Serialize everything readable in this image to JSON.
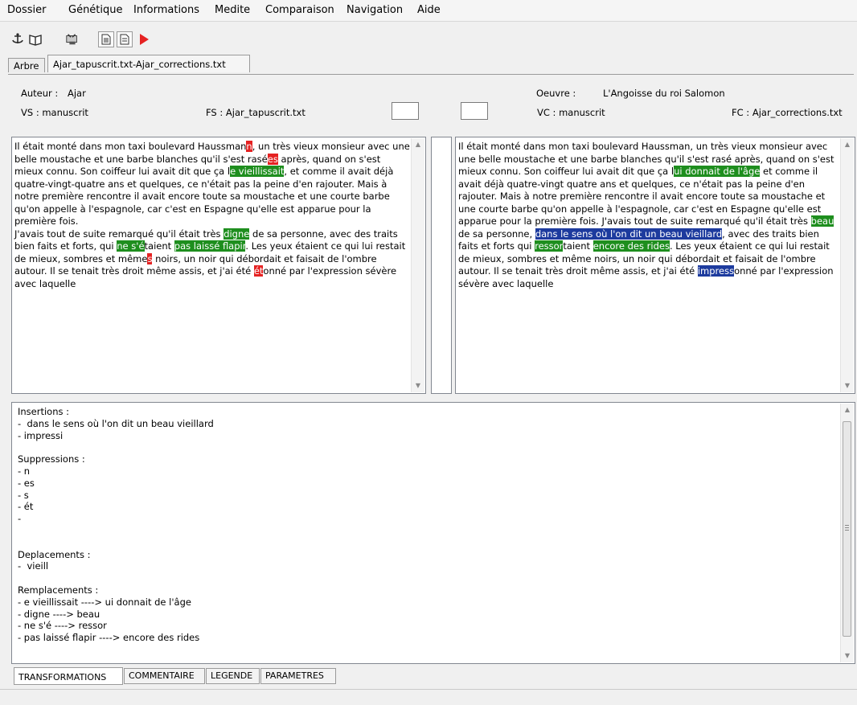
{
  "menu": [
    "Dossier",
    "Génétique",
    "Informations",
    "Medite",
    "Comparaison",
    "Navigation",
    "Aide"
  ],
  "toolbar": {
    "icons": [
      "anchor-icon",
      "book-icon",
      "tools-icon",
      "document-icon",
      "document-alt-icon",
      "play-icon"
    ],
    "accent_color": "#e52222"
  },
  "tabs": [
    "Arbre",
    "Ajar_tapuscrit.txt-Ajar_corrections.txt"
  ],
  "header": {
    "author_label": "Auteur :",
    "author": "Ajar",
    "oeuvre_label": "Oeuvre :",
    "oeuvre": "L'Angoisse du roi Salomon",
    "vs": "VS : manuscrit",
    "fs": "FS : Ajar_tapuscrit.txt",
    "vc": "VC : manuscrit",
    "fc": "FC : Ajar_corrections.txt"
  },
  "left_text": [
    [
      "Il était monté dans mon taxi boulevard Haussman",
      ""
    ],
    [
      "n",
      "r"
    ],
    [
      ", un très vieux monsieur avec une belle moustache et une barbe blanches qu'il s'est rasé",
      ""
    ],
    [
      "es",
      "r"
    ],
    [
      " après, quand on s'est mieux connu. Son coiffeur lui avait dit que ça l",
      ""
    ],
    [
      "e vieill",
      "g"
    ],
    [
      "issait",
      "g"
    ],
    [
      ", et comme il avait déjà quatre-vingt-quatre ans et quelques, ce n'était pas la peine d'en rajouter. Mais à notre première rencontre il avait encore toute sa moustache et une courte barbe qu'on appelle à l'espagnole, car c'est en Espagne qu'elle est apparue pour la première fois.\nJ'avais tout de suite remarqué qu'il était très ",
      ""
    ],
    [
      "digne",
      "g"
    ],
    [
      " de sa personne, avec des traits bien faits et forts, qui ",
      ""
    ],
    [
      "ne s'é",
      "g"
    ],
    [
      "taient ",
      ""
    ],
    [
      "pas laissé flapir",
      "g"
    ],
    [
      ". Les yeux étaient ce qui lui restait de mieux, sombres et même",
      ""
    ],
    [
      "s",
      "r"
    ],
    [
      " noirs, un noir qui débordait et faisait de l'ombre autour. Il se tenait très droit même assis, et j'ai été ",
      ""
    ],
    [
      "ét",
      "r"
    ],
    [
      "onné par l'expression sévère avec laquelle",
      ""
    ]
  ],
  "right_text": [
    [
      "Il était monté dans mon taxi boulevard Haussman, un très vieux monsieur avec une belle moustache et une barbe blanches qu'il s'est rasé après, quand on s'est mieux connu. Son coiffeur lui avait dit que ça l",
      ""
    ],
    [
      "ui donnait de l'âge",
      "g"
    ],
    [
      " et comme il avait déjà quatre-vingt quatre ans et quelques, ce n'était pas la peine d'en rajouter. Mais à notre première rencontre il avait encore toute sa moustache et une courte barbe qu'on appelle à l'espagnole, car c'est en Espagne qu'elle est apparue pour la première fois. J'avais tout de suite remarqué qu'il était très ",
      ""
    ],
    [
      "beau",
      "g"
    ],
    [
      " de sa personne, ",
      ""
    ],
    [
      "dans le sens où l'on dit un beau ",
      "b"
    ],
    [
      "vieill",
      "b"
    ],
    [
      "ard",
      "b"
    ],
    [
      ", avec des traits bien faits et forts qui ",
      ""
    ],
    [
      "ressor",
      "g"
    ],
    [
      "taient ",
      ""
    ],
    [
      "encore des rides",
      "g"
    ],
    [
      ". Les yeux étaient ce qui lui restait de mieux, sombres et même noirs, un noir qui débordait et faisait de l'ombre autour. Il se tenait très droit même assis, et j'ai été ",
      ""
    ],
    [
      "impress",
      "b"
    ],
    [
      "onné par l'expression sévère avec laquelle",
      ""
    ]
  ],
  "summary": "Insertions :\n-  dans le sens où l'on dit un beau vieillard\n- impressi\n\nSuppressions :\n- n\n- es\n- s\n- ét\n-\n\n\nDeplacements :\n-  vieill\n\nRemplacements :\n- e vieillissait ----> ui donnait de l'âge\n- digne ----> beau\n- ne s'é ----> ressor\n- pas laissé flapir ----> encore des rides",
  "bottom_tabs": [
    "TRANSFORMATIONS",
    "COMMENTAIRE",
    "LEGENDE",
    "PARAMETRES"
  ],
  "colors": {
    "insertion": "#1d3b9e",
    "suppression": "#e52222",
    "replacement": "#1e8e1e"
  }
}
